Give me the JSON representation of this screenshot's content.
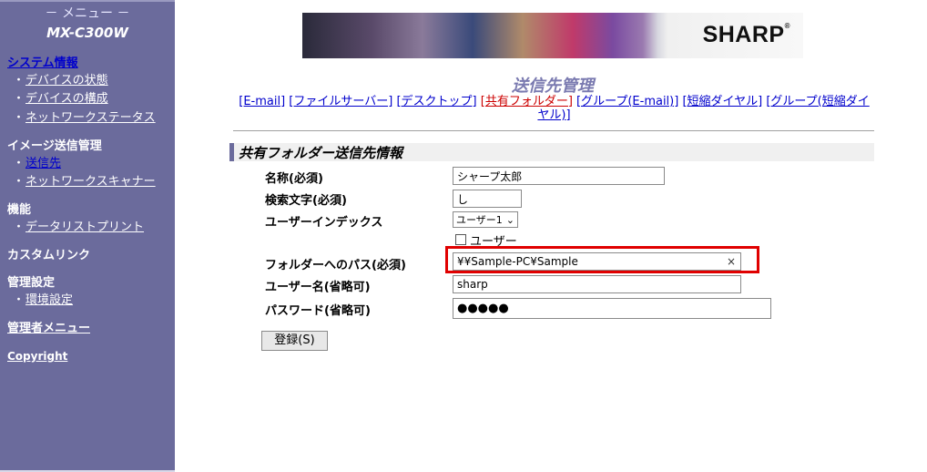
{
  "sidebar": {
    "menu_title": "－ メニュー －",
    "model": "MX-C300W",
    "system_info": {
      "label": "システム情報",
      "items": [
        "デバイスの状態",
        "デバイスの構成",
        "ネットワークステータス"
      ]
    },
    "image_send": {
      "label": "イメージ送信管理",
      "items": [
        "送信先",
        "ネットワークスキャナー"
      ]
    },
    "functions": {
      "label": "機能",
      "items": [
        "データリストプリント"
      ]
    },
    "custom_link": "カスタムリンク",
    "admin_settings": {
      "label": "管理設定",
      "items": [
        "環境設定"
      ]
    },
    "admin_menu": "管理者メニュー",
    "copyright": "Copyright",
    "bullet": "・"
  },
  "banner": {
    "logo_text": "SHARP",
    "logo_mark": "®"
  },
  "page_title": "送信先管理",
  "nav": {
    "email": "[E-mail]",
    "file_server": "[ファイルサーバー]",
    "desktop": "[デスクトップ]",
    "shared_folder": "[共有フォルダー]",
    "group_email": "[グループ(E-mail)]",
    "speed_dial": "[短縮ダイヤル]",
    "group_speed_dial": "[グループ(短縮ダイヤル)]"
  },
  "section_title": "共有フォルダー送信先情報",
  "form": {
    "name": {
      "label": "名称(必須)",
      "value": "シャープ太郎"
    },
    "search_char": {
      "label": "検索文字(必須)",
      "value": "し"
    },
    "user_index": {
      "label": "ユーザーインデックス",
      "selected": "ユーザー1"
    },
    "user_checkbox_label": "ユーザー",
    "folder_path": {
      "label": "フォルダーへのパス(必須)",
      "value": "¥¥Sample-PC¥Sample"
    },
    "username": {
      "label": "ユーザー名(省略可)",
      "value": "sharp"
    },
    "password": {
      "label": "パスワード(省略可)",
      "value": "●●●●●"
    }
  },
  "buttons": {
    "register": "登録(S)"
  },
  "icons": {
    "clear": "×",
    "dropdown": "⌄"
  },
  "colors": {
    "sidebar_bg": "#6b6b9c",
    "highlight": "#e00000",
    "title": "#7a7ab0",
    "link": "#0000cc",
    "active_link": "#cc0000"
  }
}
